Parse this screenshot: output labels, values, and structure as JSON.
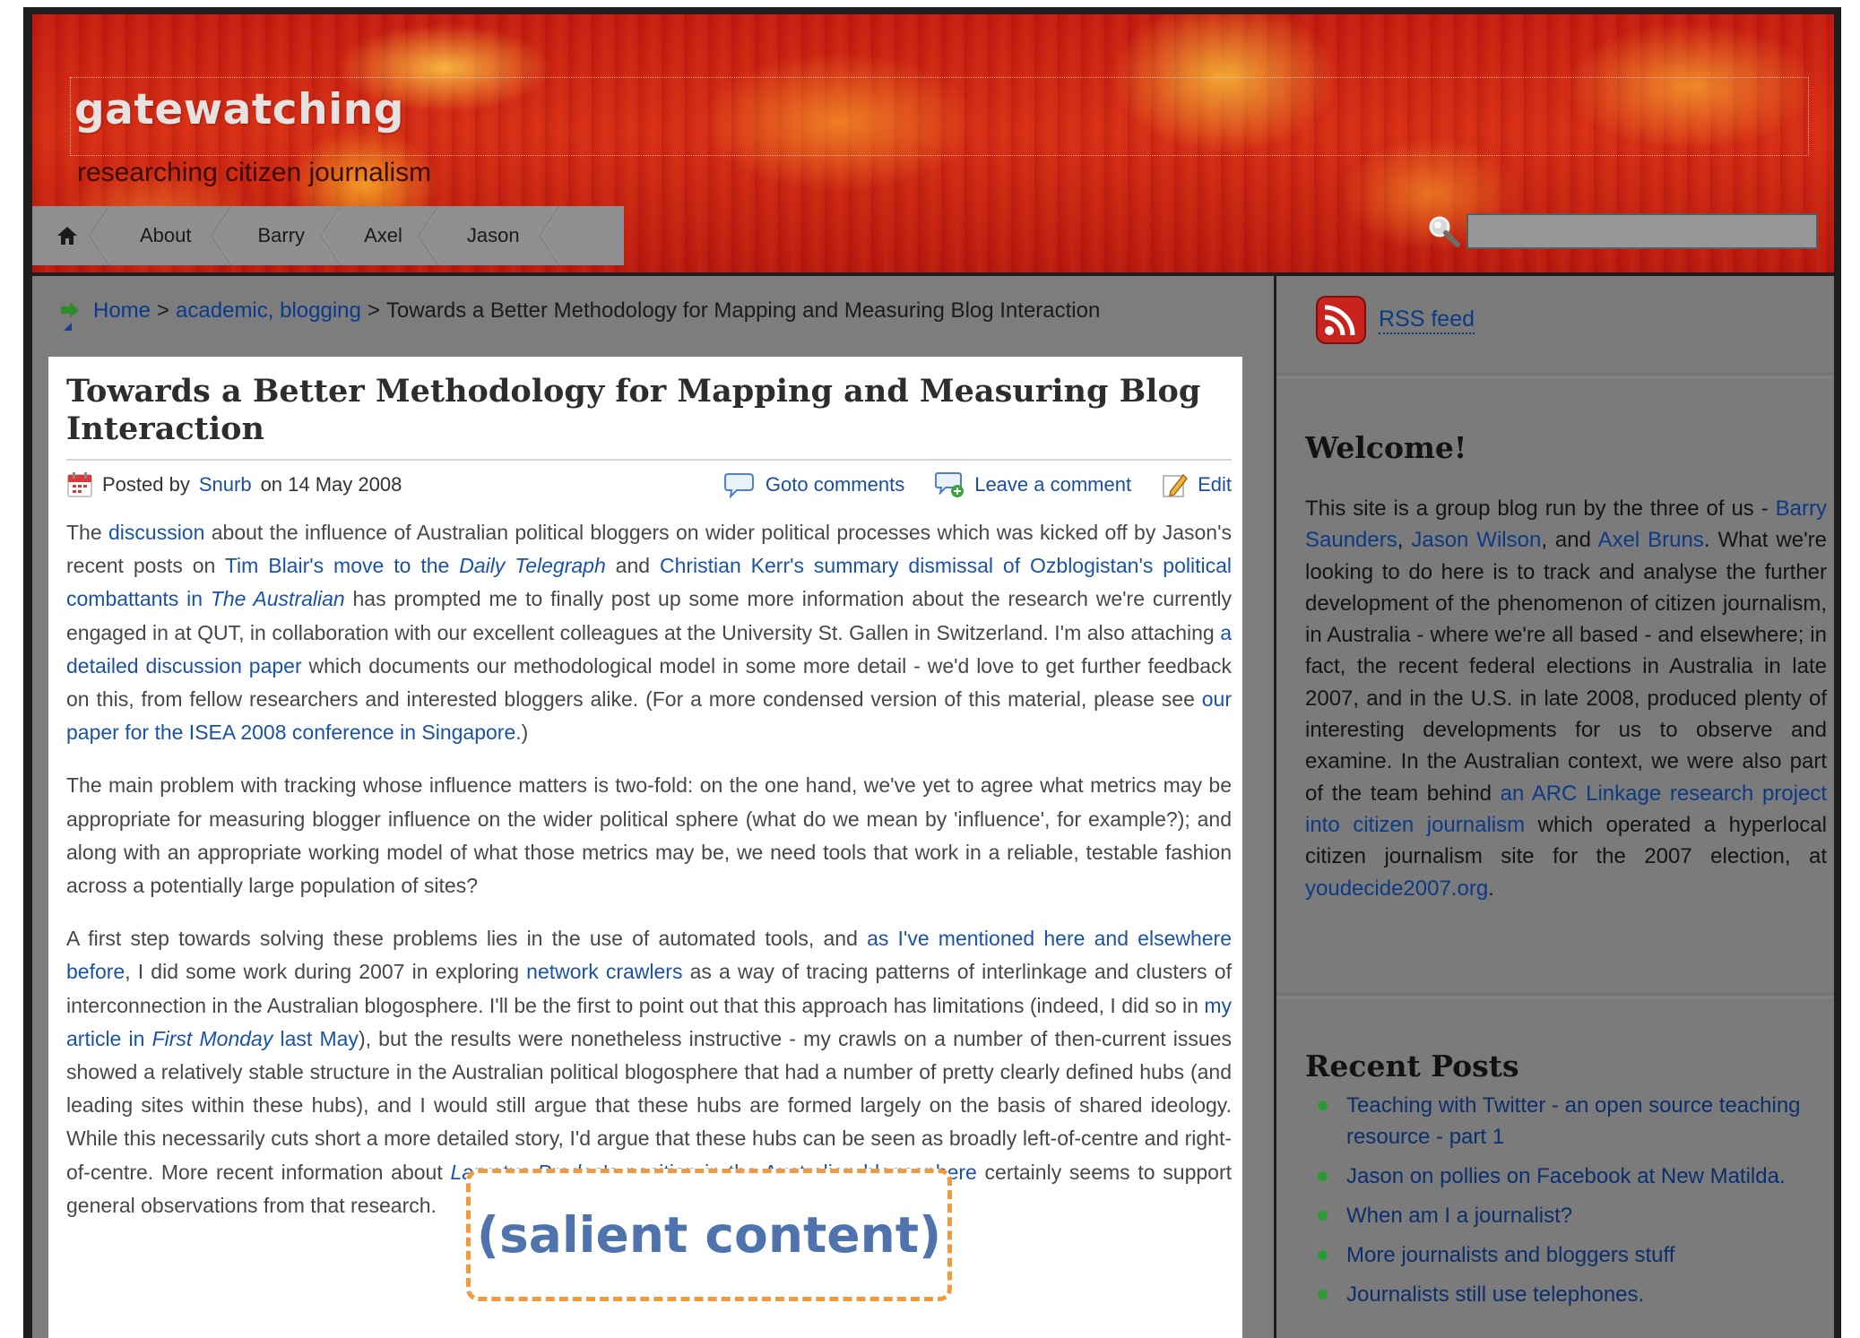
{
  "site": {
    "title": "gatewatching",
    "tagline": "researching citizen journalism"
  },
  "nav": {
    "home_icon": "home-icon",
    "items": [
      "About",
      "Barry",
      "Axel",
      "Jason"
    ]
  },
  "search": {
    "icon": "magnifier-icon",
    "value": ""
  },
  "breadcrumb": {
    "icon": "green-arrow-icon",
    "home": "Home",
    "sep": ">",
    "cat1": "academic,",
    "cat2": "blogging",
    "current": "Towards a Better Methodology for Mapping and Measuring Blog Interaction"
  },
  "post": {
    "title": "Towards a Better Methodology for Mapping and Measuring Blog Interaction",
    "meta": {
      "calendar_icon": "calendar-icon",
      "posted_by": "Posted by",
      "author": "Snurb",
      "on": "on 14 May 2008",
      "goto_comments": "Goto comments",
      "leave_comment": "Leave a comment",
      "edit": "Edit"
    },
    "p1": {
      "t1": "The ",
      "l1": "discussion",
      "t2": " about the influence of Australian political bloggers on wider political processes which was kicked off by Jason's recent posts on ",
      "l2": "Tim Blair's move to the ",
      "l2i": "Daily Telegraph",
      "t3": " and ",
      "l3": "Christian Kerr's summary dismissal of Ozblogistan's political combattants in ",
      "l3i": "The Australian",
      "t4": " has prompted me to finally post up some more information about the research we're currently engaged in at QUT, in collaboration with our excellent colleagues at the University St. Gallen in Switzerland. I'm also attaching ",
      "l4": "a detailed discussion paper",
      "t5": " which documents our methodological model in some more detail - we'd love to get further feedback on this, from fellow researchers and interested bloggers alike. (For a more condensed version of this material, please see ",
      "l5": "our paper for the ISEA 2008 conference in Singapore",
      "t6": ".)"
    },
    "p2": "The main problem with tracking whose influence matters is two-fold: on the one hand, we've yet to agree what metrics may be appropriate for measuring blogger influence on the wider political sphere (what do we mean by 'influence', for example?); and along with an appropriate working model of what those metrics may be, we need tools that work in a reliable, testable fashion across a potentially large population of sites?",
    "salient_label": "(salient content)",
    "p3": {
      "t1": "A first step towards solving these problems lies in the use of automated tools, and ",
      "l1": "as I've mentioned here and elsewhere before",
      "t2": ", I did some work during 2007 in exploring ",
      "l2": "network crawlers",
      "t3": " as a way of tracing patterns of interlinkage and clusters of interconnection in the Australian blogosphere. I'll be the first to point out that this approach has limitations (indeed, I did so in ",
      "l3": "my article in ",
      "l3i": "First Monday",
      "l3b": " last May",
      "t4": "), but the results were nonetheless instructive - my crawls on a number of then-current issues showed a relatively stable structure in the Australian political blogosphere that had a number of pretty clearly defined hubs (and leading sites within these hubs), and I would still argue that these hubs are formed largely on the basis of shared ideology. While this necessarily cuts short a more detailed story, I'd argue that these hubs can be seen as broadly left-of-centre and right-of-centre. More recent information about ",
      "l4i": "Larvatus Prodeo",
      "l4": "'s position in the Australian blogosphere",
      "t5": " certainly seems to support general observations from that research."
    }
  },
  "sidebar": {
    "rss_icon": "rss-icon",
    "rss_label": "RSS feed",
    "welcome_heading": "Welcome!",
    "welcome": {
      "t1": "This site is a group blog run by the three of us - ",
      "l1": "Barry Saunders",
      "t2": ", ",
      "l2": "Jason Wilson",
      "t3": ", and ",
      "l3": "Axel Bruns",
      "t4": ". What we're looking to do here is to track and analyse the further development of the phenomenon of citizen journalism, in Australia - where we're all based - and elsewhere; in fact, the recent federal elections in Australia in late 2007, and in the U.S. in late 2008, produced plenty of interesting developments for us to observe and examine. In the Australian context, we were also part of the team behind ",
      "l4": "an ARC Linkage research project into citizen journalism",
      "t5": " which operated a hyperlocal citizen journalism site for the 2007 election, at ",
      "l5": "youdecide2007.org",
      "t6": "."
    },
    "recent_heading": "Recent Posts",
    "recent_posts": [
      "Teaching with Twitter - an open source teaching resource - part 1",
      "Jason on pollies on Facebook at New Matilda.",
      "When am I a journalist?",
      "More journalists and bloggers stuff",
      "Journalists still use telephones."
    ]
  }
}
